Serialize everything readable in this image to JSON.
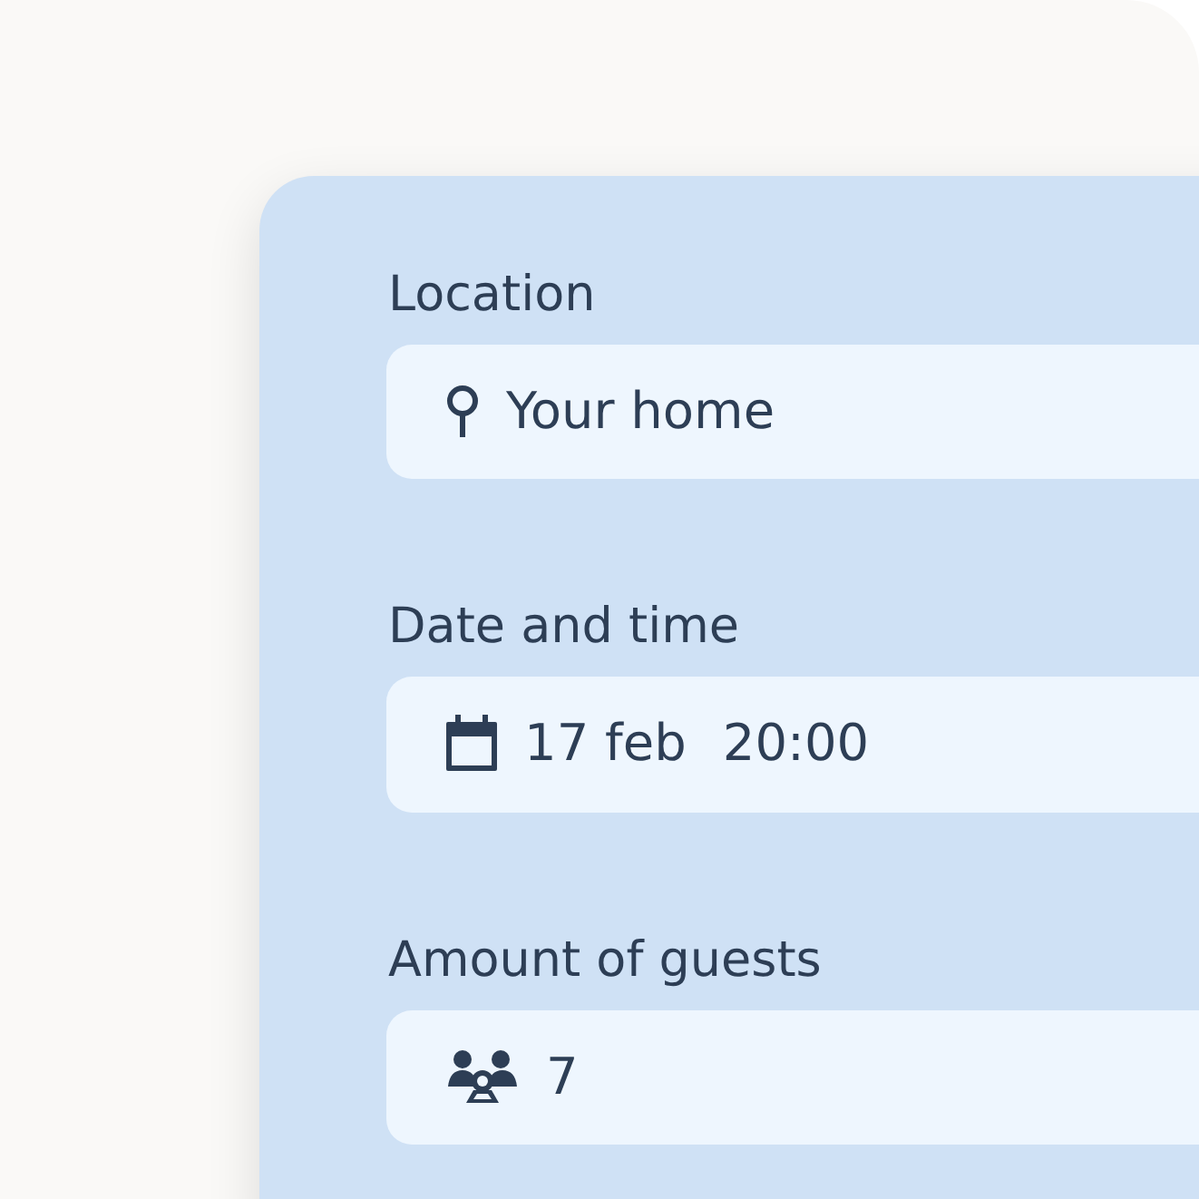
{
  "fields": [
    {
      "kind": "location",
      "label": "Location",
      "value": "Your home"
    },
    {
      "kind": "datetime",
      "label": "Date and time",
      "date": "17 feb",
      "time": "20:00"
    },
    {
      "kind": "guests",
      "label": "Amount of guests",
      "value": "7"
    }
  ]
}
